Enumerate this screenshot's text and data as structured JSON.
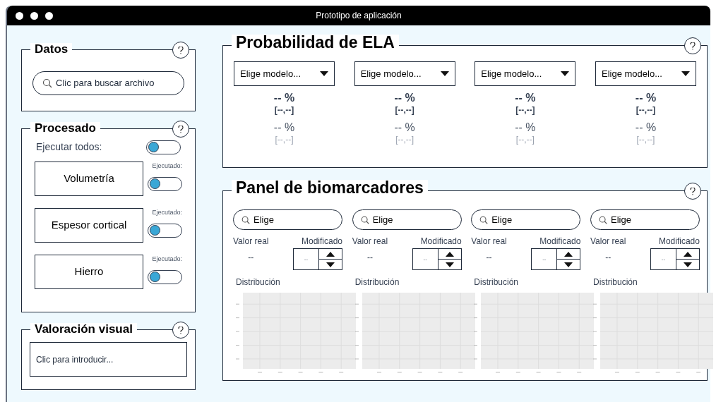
{
  "window": {
    "title": "Prototipo de aplicación"
  },
  "datos": {
    "title": "Datos",
    "search": {
      "placeholder": "Clic para buscar archivo"
    }
  },
  "procesado": {
    "title": "Procesado",
    "run_all": {
      "label": "Ejecutar todos:",
      "on": false
    },
    "steps": [
      {
        "label": "Volumetría",
        "status_label": "Ejecutado:",
        "on": false
      },
      {
        "label": "Espesor cortical",
        "status_label": "Ejecutado:",
        "on": false
      },
      {
        "label": "Hierro",
        "status_label": "Ejecutado:",
        "on": false
      }
    ]
  },
  "valoracion": {
    "title": "Valoración visual",
    "input": {
      "placeholder": "Clic para introducir..."
    }
  },
  "probabilidad": {
    "title": "Probabilidad de ELA",
    "models": [
      {
        "dropdown": "Elige modelo...",
        "main_value": "-- %",
        "main_interval": "[--,--]",
        "alt_value": "-- %",
        "alt_interval": "[--,--]"
      },
      {
        "dropdown": "Elige modelo...",
        "main_value": "-- %",
        "main_interval": "[--,--]",
        "alt_value": "-- %",
        "alt_interval": "[--,--]"
      },
      {
        "dropdown": "Elige modelo...",
        "main_value": "-- %",
        "main_interval": "[--,--]",
        "alt_value": "-- %",
        "alt_interval": "[--,--]"
      },
      {
        "dropdown": "Elige modelo...",
        "main_value": "-- %",
        "main_interval": "[--,--]",
        "alt_value": "-- %",
        "alt_interval": "[--,--]"
      }
    ]
  },
  "biomarcadores": {
    "title": "Panel de biomarcadores",
    "columns": [
      {
        "search": "Elige",
        "real_label": "Valor real",
        "real_value": "--",
        "mod_label": "Modificado",
        "mod_value": "--",
        "dist_label": "Distribución"
      },
      {
        "search": "Elige",
        "real_label": "Valor real",
        "real_value": "--",
        "mod_label": "Modificado",
        "mod_value": "--",
        "dist_label": "Distribución"
      },
      {
        "search": "Elige",
        "real_label": "Valor real",
        "real_value": "--",
        "mod_label": "Modificado",
        "mod_value": "--",
        "dist_label": "Distribución"
      },
      {
        "search": "Elige",
        "real_label": "Valor real",
        "real_value": "--",
        "mod_label": "Modificado",
        "mod_value": "--",
        "dist_label": "Distribución"
      }
    ]
  }
}
